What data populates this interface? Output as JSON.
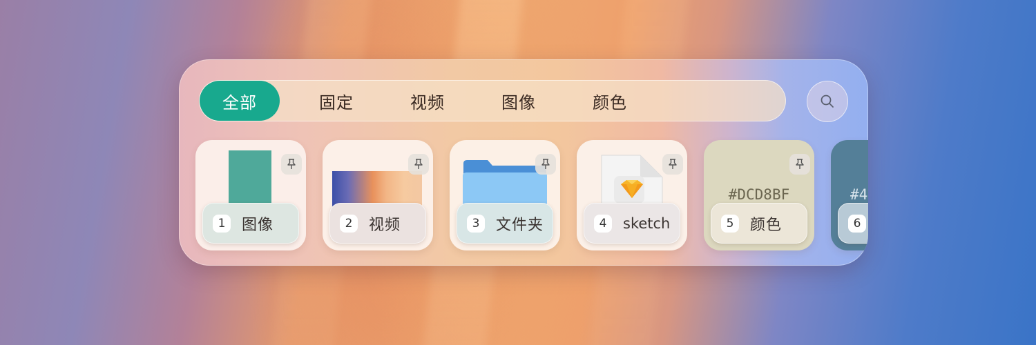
{
  "tabs": [
    {
      "label": "全部",
      "active": true
    },
    {
      "label": "固定",
      "active": false
    },
    {
      "label": "视频",
      "active": false
    },
    {
      "label": "图像",
      "active": false
    },
    {
      "label": "颜色",
      "active": false
    }
  ],
  "search_icon": "search-icon",
  "pin_icon": "pin-icon",
  "cards": [
    {
      "index": "1",
      "label": "图像",
      "kind": "image",
      "swatch": "#4fa99a",
      "bg": "#fbeee9",
      "label_bg": "#dde6e1",
      "pinned": true
    },
    {
      "index": "2",
      "label": "视频",
      "kind": "video",
      "bg": "#fcf0e8",
      "label_bg": "#ebe2e0",
      "pinned": true
    },
    {
      "index": "3",
      "label": "文件夹",
      "kind": "folder",
      "bg": "#fcf0e6",
      "label_bg": "#d8e6e6",
      "pinned": true
    },
    {
      "index": "4",
      "label": "sketch",
      "kind": "sketch-file",
      "bg": "#fbf0e8",
      "label_bg": "#ebe6e6",
      "pinned": true
    },
    {
      "index": "5",
      "label": "颜色",
      "kind": "color",
      "hex": "#DCD8BF",
      "bg": "#dcd8bf",
      "label_bg": "#ece6d8",
      "pinned": true
    },
    {
      "index": "6",
      "label": "",
      "kind": "color",
      "hex": "#4",
      "bg": "#547f98",
      "label_bg": "#b8cad6",
      "pinned": false
    }
  ],
  "colors": {
    "accent": "#18a98e"
  }
}
